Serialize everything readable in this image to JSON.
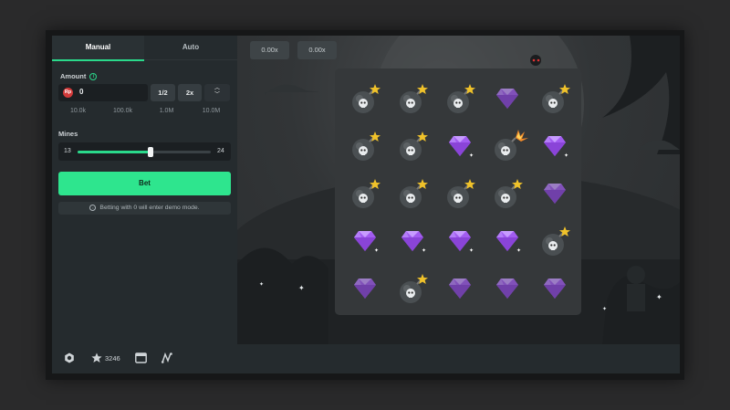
{
  "tabs": {
    "manual": "Manual",
    "auto": "Auto"
  },
  "amount": {
    "label": "Amount",
    "currency": "Rp",
    "value": "0",
    "half_label": "1/2",
    "double_label": "2x",
    "quick_values": [
      "10.0k",
      "100.0k",
      "1.0M",
      "10.0M"
    ]
  },
  "mines": {
    "label": "Mines",
    "min": "13",
    "max": "24",
    "value": 19
  },
  "bet_button": "Bet",
  "demo_note": "Betting with 0 will enter demo mode.",
  "multipliers": [
    "0.00x",
    "0.00x"
  ],
  "board": {
    "rows": [
      [
        "bomb",
        "bomb",
        "bomb",
        "gem-dim",
        "bomb"
      ],
      [
        "bomb",
        "bomb",
        "gem",
        "bomb-exploded",
        "gem"
      ],
      [
        "bomb",
        "bomb",
        "bomb",
        "bomb",
        "gem-dim"
      ],
      [
        "gem",
        "gem",
        "gem",
        "gem",
        "bomb"
      ],
      [
        "gem-dim",
        "bomb",
        "gem-dim",
        "gem-dim",
        "gem-dim"
      ]
    ]
  },
  "footer": {
    "favorites_count": "3246"
  },
  "icons": [
    "settings-icon",
    "star-icon",
    "theater-icon",
    "fairness-icon"
  ],
  "colors": {
    "accent": "#2ee58e",
    "gem": "#a25cf0",
    "bomb": "#4a4f52",
    "fuse": "#f0c22a"
  }
}
